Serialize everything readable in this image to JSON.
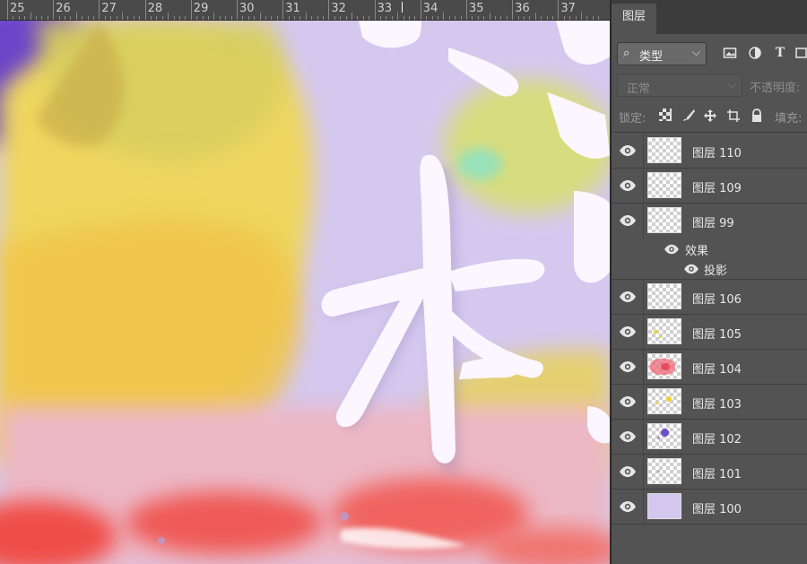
{
  "ruler": {
    "numbers": [
      "25",
      "26",
      "27",
      "28",
      "29",
      "30",
      "31",
      "32",
      "33",
      "34",
      "35",
      "36",
      "37"
    ]
  },
  "panel": {
    "tab_label": "图层",
    "filter": {
      "kind_label": "类型"
    },
    "blend_mode": "正常",
    "opacity_label": "不透明度:",
    "lock_label": "锁定:",
    "fill_label": "填充:",
    "layers": [
      {
        "name": "图层 110",
        "thumb": "empty"
      },
      {
        "name": "图层 109",
        "thumb": "empty"
      },
      {
        "name": "图层 99",
        "thumb": "empty",
        "effects": {
          "label": "效果",
          "items": [
            "投影"
          ]
        }
      },
      {
        "name": "图层 106",
        "thumb": "empty"
      },
      {
        "name": "图层 105",
        "thumb": "yellow-dots"
      },
      {
        "name": "图层 104",
        "thumb": "red-brush"
      },
      {
        "name": "图层 103",
        "thumb": "yellow-dot"
      },
      {
        "name": "图层 102",
        "thumb": "purple-dot"
      },
      {
        "name": "图层 101",
        "thumb": "faint"
      },
      {
        "name": "图层 100",
        "thumb": "lavender-fill"
      }
    ]
  },
  "canvas": {
    "characters": [
      "本"
    ],
    "colors": {
      "background": "#d3c7ee",
      "yellow": "#f2d85a",
      "red": "#f0433a",
      "purple": "#6a45c8",
      "pink": "#ecb4bf"
    }
  }
}
